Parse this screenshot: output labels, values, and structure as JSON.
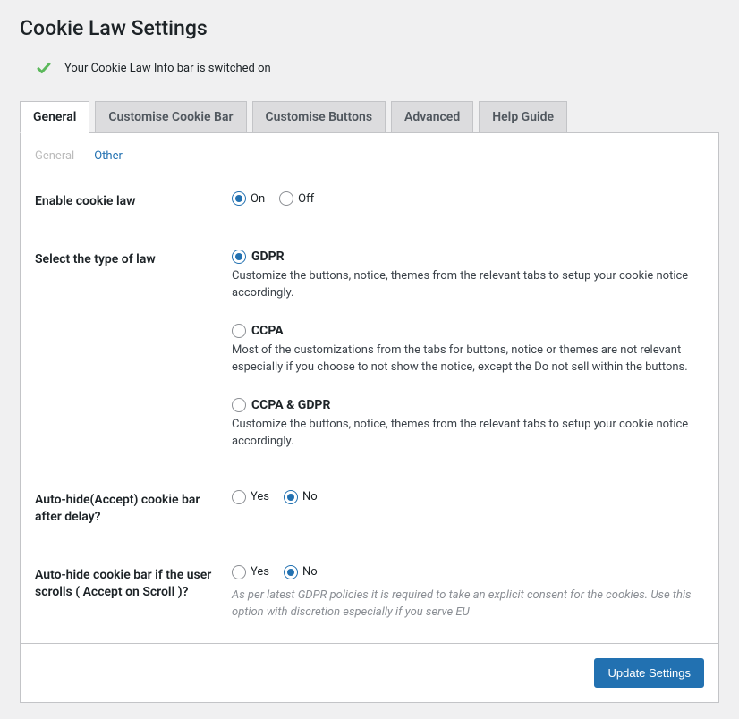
{
  "page_title": "Cookie Law Settings",
  "status": {
    "text": "Your Cookie Law Info bar is switched on"
  },
  "tabs": [
    {
      "label": "General",
      "active": true
    },
    {
      "label": "Customise Cookie Bar",
      "active": false
    },
    {
      "label": "Customise Buttons",
      "active": false
    },
    {
      "label": "Advanced",
      "active": false
    },
    {
      "label": "Help Guide",
      "active": false
    }
  ],
  "sub_tabs": {
    "general": "General",
    "other": "Other"
  },
  "enable": {
    "label": "Enable cookie law",
    "on": "On",
    "off": "Off",
    "value": "on"
  },
  "law_type": {
    "label": "Select the type of law",
    "value": "gdpr",
    "options": {
      "gdpr": {
        "title": "GDPR",
        "desc": "Customize the buttons, notice, themes from the relevant tabs to setup your cookie notice accordingly."
      },
      "ccpa": {
        "title": "CCPA",
        "desc": "Most of the customizations from the tabs for buttons, notice or themes are not relevant especially if you choose to not show the notice, except the Do not sell within the buttons."
      },
      "both": {
        "title": "CCPA & GDPR",
        "desc": "Customize the buttons, notice, themes from the relevant tabs to setup your cookie notice accordingly."
      }
    }
  },
  "auto_hide_delay": {
    "label": "Auto-hide(Accept) cookie bar after delay?",
    "yes": "Yes",
    "no": "No",
    "value": "no"
  },
  "auto_hide_scroll": {
    "label": "Auto-hide cookie bar if the user scrolls ( Accept on Scroll )?",
    "yes": "Yes",
    "no": "No",
    "value": "no",
    "hint": "As per latest GDPR policies it is required to take an explicit consent for the cookies. Use this option with discretion especially if you serve EU"
  },
  "submit_label": "Update Settings"
}
